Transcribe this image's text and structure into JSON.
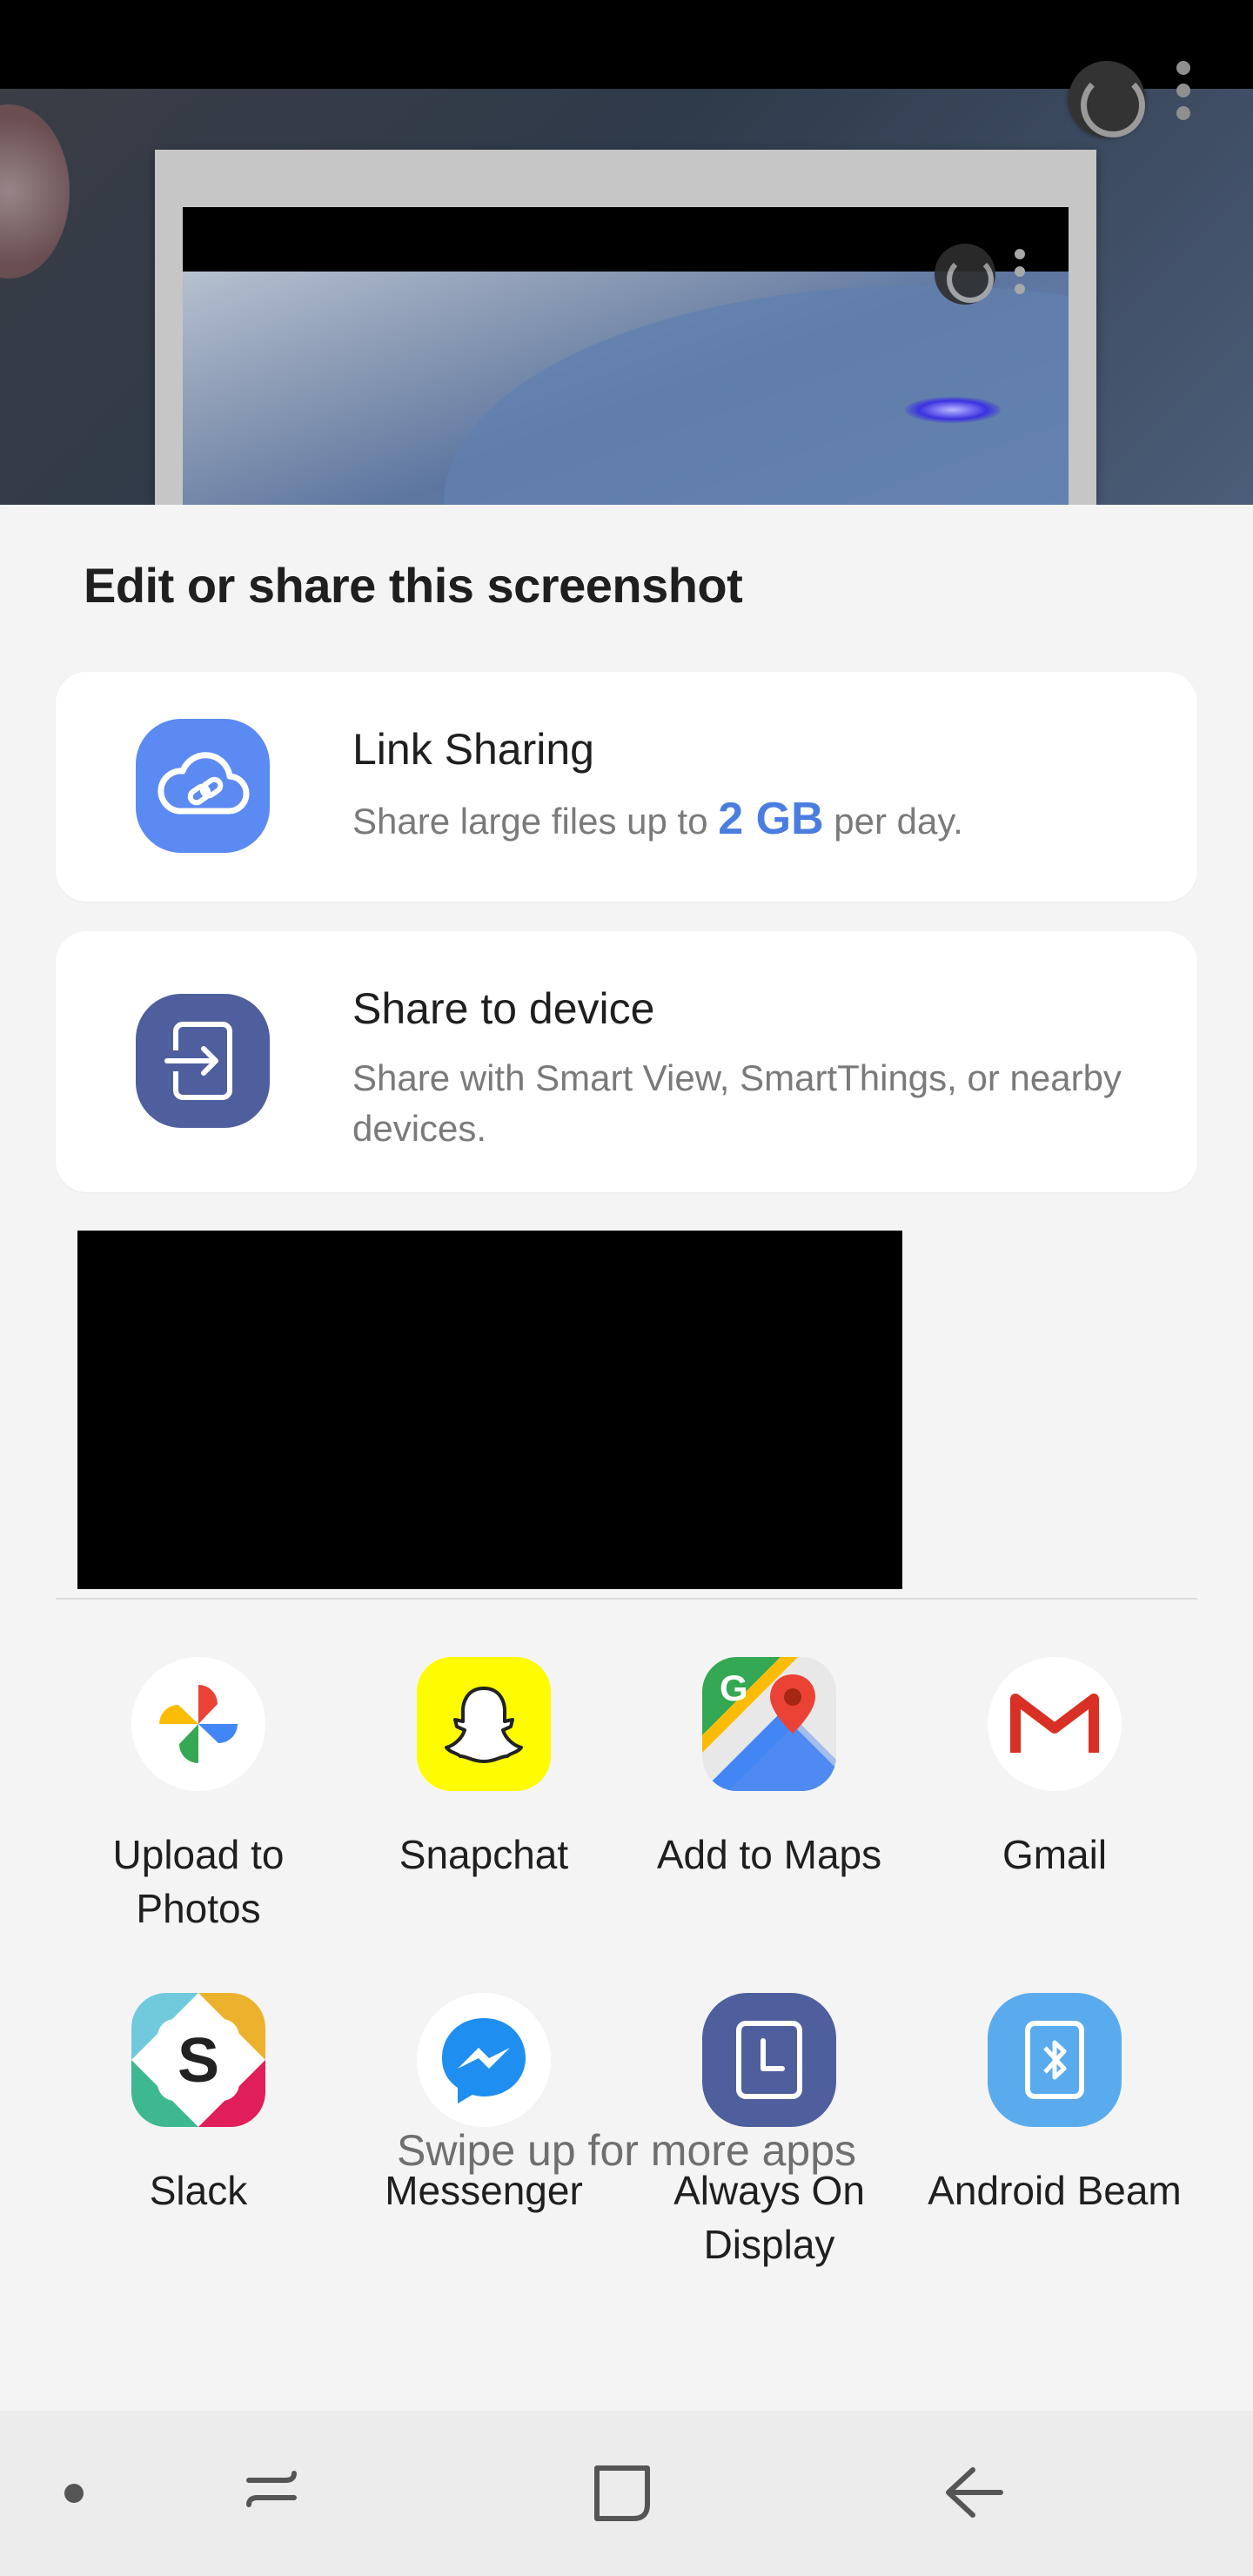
{
  "sheet": {
    "title": "Edit or share this screenshot"
  },
  "link_sharing": {
    "title": "Link Sharing",
    "subtitle_before": "Share large files up to ",
    "subtitle_highlight": "2 GB",
    "subtitle_after": " per day.",
    "icon": "cloud-link-icon",
    "color": "#5b8af2"
  },
  "share_to_device": {
    "title": "Share to device",
    "subtitle": "Share with Smart View, SmartThings, or nearby devices.",
    "icon": "share-device-icon",
    "color": "#4f5f9e"
  },
  "apps": [
    {
      "label": "Upload to Photos",
      "icon": "google-photos-icon"
    },
    {
      "label": "Snapchat",
      "icon": "snapchat-icon"
    },
    {
      "label": "Add to Maps",
      "icon": "google-maps-icon"
    },
    {
      "label": "Gmail",
      "icon": "gmail-icon"
    },
    {
      "label": "Slack",
      "icon": "slack-icon"
    },
    {
      "label": "Messenger",
      "icon": "messenger-icon"
    },
    {
      "label": "Always On Display",
      "icon": "always-on-display-icon"
    },
    {
      "label": "Android Beam",
      "icon": "android-beam-icon"
    }
  ],
  "swipe_hint": "Swipe up for more apps",
  "navbar": {
    "buttons": [
      "recents-icon",
      "home-icon",
      "back-icon"
    ]
  }
}
